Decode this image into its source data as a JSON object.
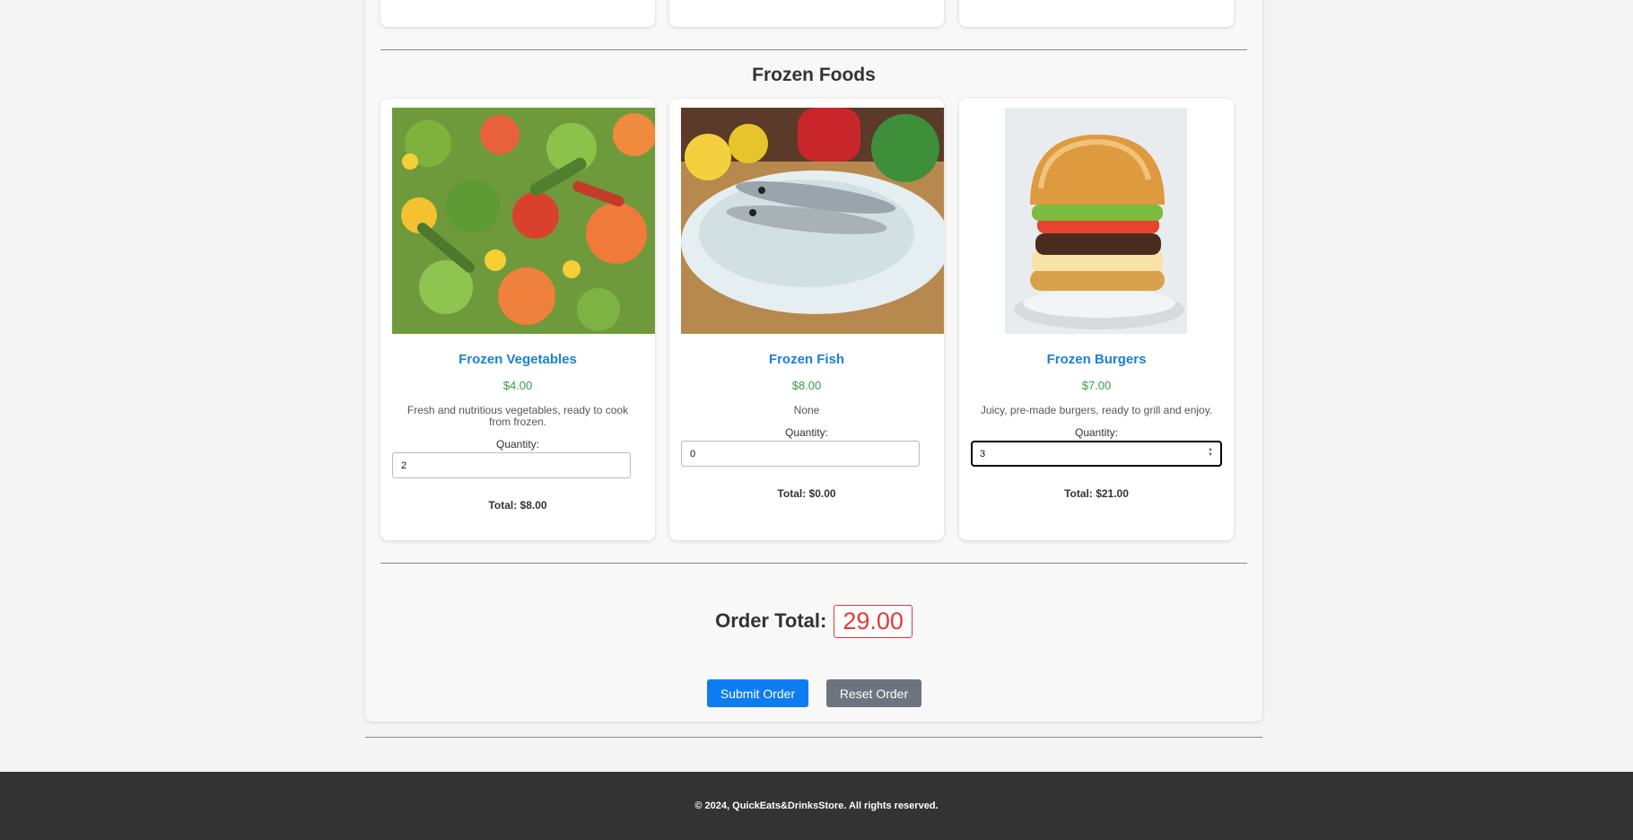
{
  "section": {
    "title": "Frozen Foods"
  },
  "products": [
    {
      "name": "Frozen Vegetables",
      "price": "$4.00",
      "description": "Fresh and nutritious vegetables, ready to cook from frozen.",
      "quantity_label": "Quantity:",
      "quantity": "2",
      "total": "Total: $8.00"
    },
    {
      "name": "Frozen Fish",
      "price": "$8.00",
      "description": "None",
      "quantity_label": "Quantity:",
      "quantity": "0",
      "total": "Total: $0.00"
    },
    {
      "name": "Frozen Burgers",
      "price": "$7.00",
      "description": "Juicy, pre-made burgers, ready to grill and enjoy.",
      "quantity_label": "Quantity:",
      "quantity": "3",
      "total": "Total: $21.00"
    }
  ],
  "order": {
    "label": "Order Total:",
    "value": "29.00"
  },
  "buttons": {
    "submit": "Submit Order",
    "reset": "Reset Order"
  },
  "footer": {
    "text": "© 2024, QuickEats&DrinksStore. All rights reserved."
  },
  "colors": {
    "accent_blue": "#0d7cf2",
    "title_blue": "#1a7fd8",
    "price_green": "#33a142",
    "total_red": "#e53935",
    "reset_gray": "#6c757d",
    "footer_bg": "#333333"
  }
}
